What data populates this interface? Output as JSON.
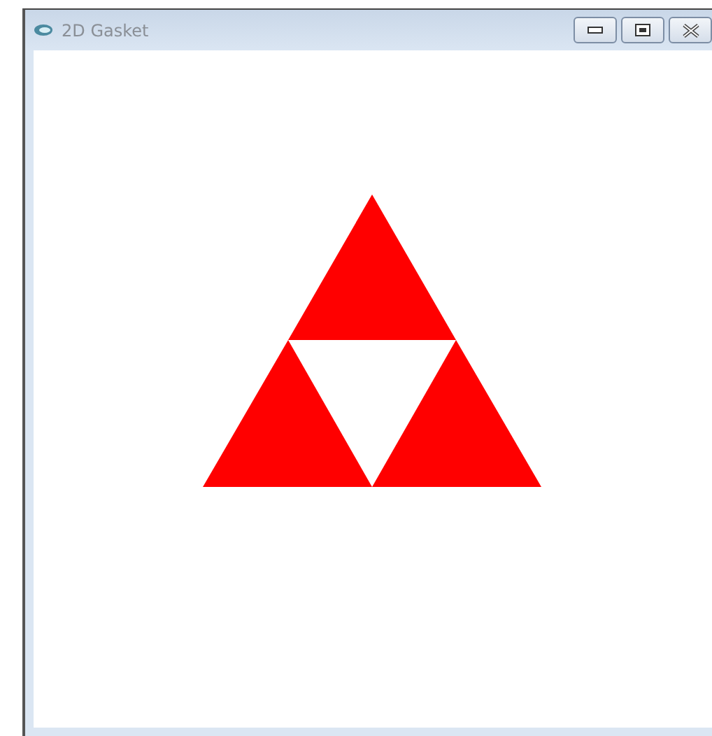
{
  "window": {
    "title": "2D Gasket"
  }
}
